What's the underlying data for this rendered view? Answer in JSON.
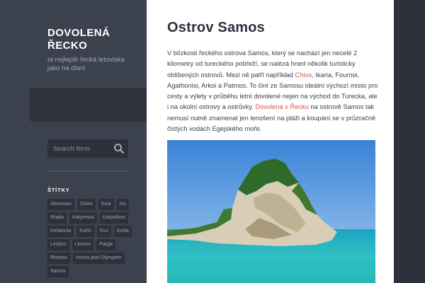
{
  "site": {
    "title": "DOVOLENÁ ŘECKO",
    "tagline": "ta nejlepší řecká letoviska jako na dlani"
  },
  "search": {
    "placeholder": "Search form"
  },
  "tags": {
    "heading": "ŠTÍTKY",
    "items": [
      "Alonissos",
      "Chios",
      "Evia",
      "Ios",
      "Ithaka",
      "Kalymnos",
      "Karpathos",
      "Kefalonia",
      "Korfu",
      "Kos",
      "Kréta",
      "Lesbos",
      "Limnos",
      "Parga",
      "Rhodos",
      "riviera pod Olympem",
      "Samos"
    ]
  },
  "article": {
    "title": "Ostrov Samos",
    "p1": "V blízkosti řeckého ostrova Samos, který se nachází jen necelé 2 kilometry od tureckého pobřeží, se nalézá hned několik turisticky oblíbených ostrovů. Mezi ně patří například ",
    "link1": "Chios",
    "p2": ", Ikaria, Fournoi, Agathonisi, Arkoi a Patmos. To činí ze Samosu ideální výchozí místo pro cesty a výlety v průběhu letní dovolené nejen na východ do Turecka, ale i na okolní ostrovy a ostrůvky. ",
    "link2": "Dovolená v Řecku",
    "p3": " na ostrově Samos tak nemusí nutně znamenat jen lenošení na pláži a koupání se v průzračně čistých vodách Egejského moře."
  },
  "colors": {
    "sidebar": "#3b414d",
    "dark": "#2c313c",
    "link": "#e24f4f"
  }
}
